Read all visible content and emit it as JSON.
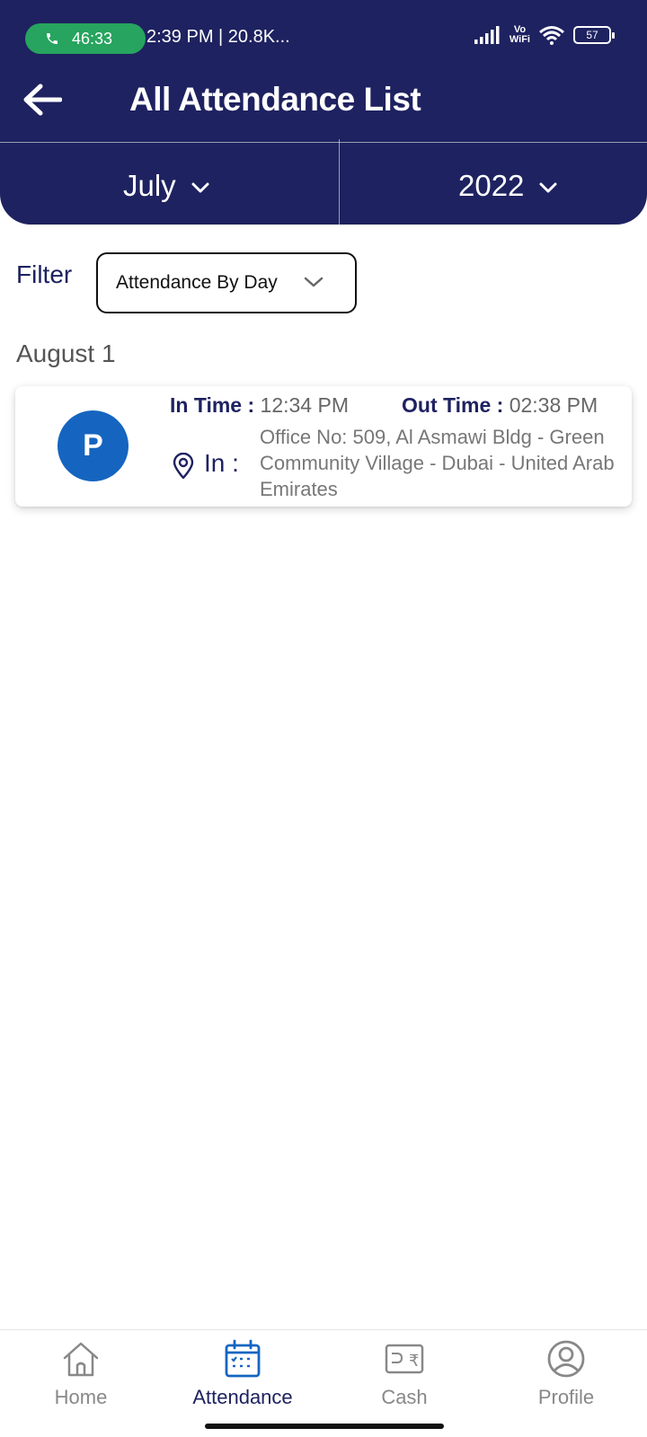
{
  "status_bar": {
    "call_timer": "46:33",
    "status_text": "2:39 PM | 20.8K...",
    "vowifi_top": "Vo",
    "vowifi_bottom": "WiFi",
    "battery": "57"
  },
  "header": {
    "title": "All Attendance List",
    "month": "July",
    "year": "2022"
  },
  "filter": {
    "label": "Filter",
    "selected": "Attendance By Day"
  },
  "groups": [
    {
      "date": "August 1",
      "records": [
        {
          "avatar_letter": "P",
          "in_time_label": "In Time :",
          "in_time": "12:34 PM",
          "out_time_label": "Out Time :",
          "out_time": "02:38 PM",
          "location_label": "In :",
          "address": "Office No: 509, Al Asmawi Bldg - Green Community Village - Dubai - United Arab Emirates"
        }
      ]
    }
  ],
  "bottom_nav": {
    "items": [
      {
        "label": "Home",
        "icon": "home-icon"
      },
      {
        "label": "Attendance",
        "icon": "calendar-icon"
      },
      {
        "label": "Cash",
        "icon": "rupee-icon"
      },
      {
        "label": "Profile",
        "icon": "profile-icon"
      }
    ],
    "active": "Attendance"
  },
  "colors": {
    "header_bg": "#1e2260",
    "call_pill": "#27a45f",
    "avatar_bg": "#1565c0",
    "nav_active": "#1e2260",
    "nav_inactive": "#888888"
  }
}
